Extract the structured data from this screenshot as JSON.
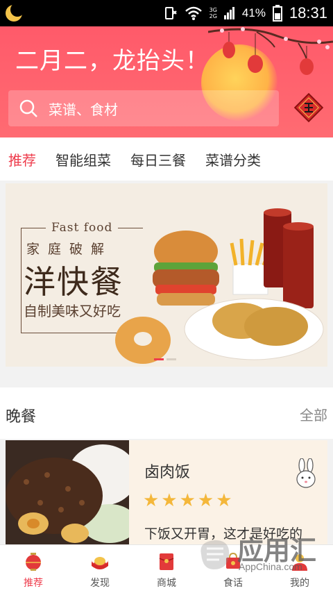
{
  "status_bar": {
    "network": [
      "3G",
      "2G"
    ],
    "battery_percent": "41%",
    "time": "18:31"
  },
  "header": {
    "banner_title": "二月二，龙抬头！",
    "search_placeholder": "菜谱、食材",
    "accent_color": "#ff5a6a"
  },
  "tabs": [
    {
      "label": "推荐",
      "active": true
    },
    {
      "label": "智能组菜",
      "active": false
    },
    {
      "label": "每日三餐",
      "active": false
    },
    {
      "label": "菜谱分类",
      "active": false
    }
  ],
  "banner": {
    "en_title": "Fast food",
    "subtitle": "家庭破解",
    "headline": "洋快餐",
    "tagline": "自制美味又好吃"
  },
  "section": {
    "name": "晚餐",
    "more_label": "全部"
  },
  "recipe_card": {
    "title": "卤肉饭",
    "rating": 5,
    "stars": "★★★★★",
    "description": "下饭又开胃，这才是好吃的"
  },
  "bottom_nav": [
    {
      "label": "推荐",
      "icon": "lantern-icon",
      "active": true
    },
    {
      "label": "发现",
      "icon": "gold-ingot-icon",
      "active": false
    },
    {
      "label": "商城",
      "icon": "red-envelope-icon",
      "active": false
    },
    {
      "label": "食话",
      "icon": "chat-bag-icon",
      "active": false
    },
    {
      "label": "我的",
      "icon": "profile-icon",
      "active": false
    }
  ],
  "watermark": {
    "text": "应用汇",
    "sub": "AppChina.com"
  }
}
